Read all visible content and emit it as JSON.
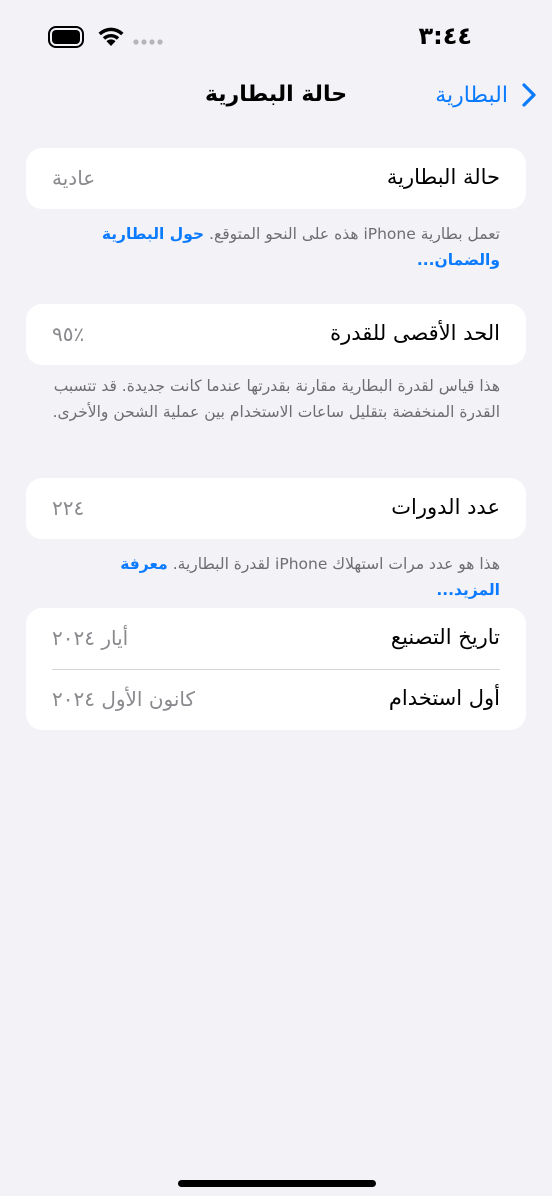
{
  "status_bar": {
    "time": "٣:٤٤",
    "battery_icon": "battery-full-icon",
    "wifi_icon": "wifi-icon",
    "signal_icon": "cellular-signal-icon"
  },
  "nav": {
    "title": "حالة البطارية",
    "back_label": "البطارية",
    "back_icon": "chevron-right-icon",
    "accent_color": "#0a7aff"
  },
  "battery_health": {
    "label": "حالة البطارية",
    "value": "عادية",
    "footer_text": "تعمل بطارية iPhone هذه على النحو المتوقع.",
    "footer_link": "حول البطارية والضمان..."
  },
  "maximum_capacity": {
    "label": "الحد الأقصى للقدرة",
    "value": "٪٩٥",
    "footer_text": "هذا قياس لقدرة البطارية مقارنة بقدرتها عندما كانت جديدة. قد تتسبب القدرة المنخفضة بتقليل ساعات الاستخدام بين عملية الشحن والأخرى."
  },
  "cycle_count": {
    "label": "عدد الدورات",
    "value": "٢٢٤",
    "footer_text": "هذا هو عدد مرات استهلاك iPhone لقدرة البطارية.",
    "footer_link": "معرفة المزيد..."
  },
  "dates": {
    "manufacture_label": "تاريخ التصنيع",
    "manufacture_value": "أيار ٢٠٢٤",
    "first_use_label": "أول استخدام",
    "first_use_value": "كانون الأول ٢٠٢٤"
  }
}
